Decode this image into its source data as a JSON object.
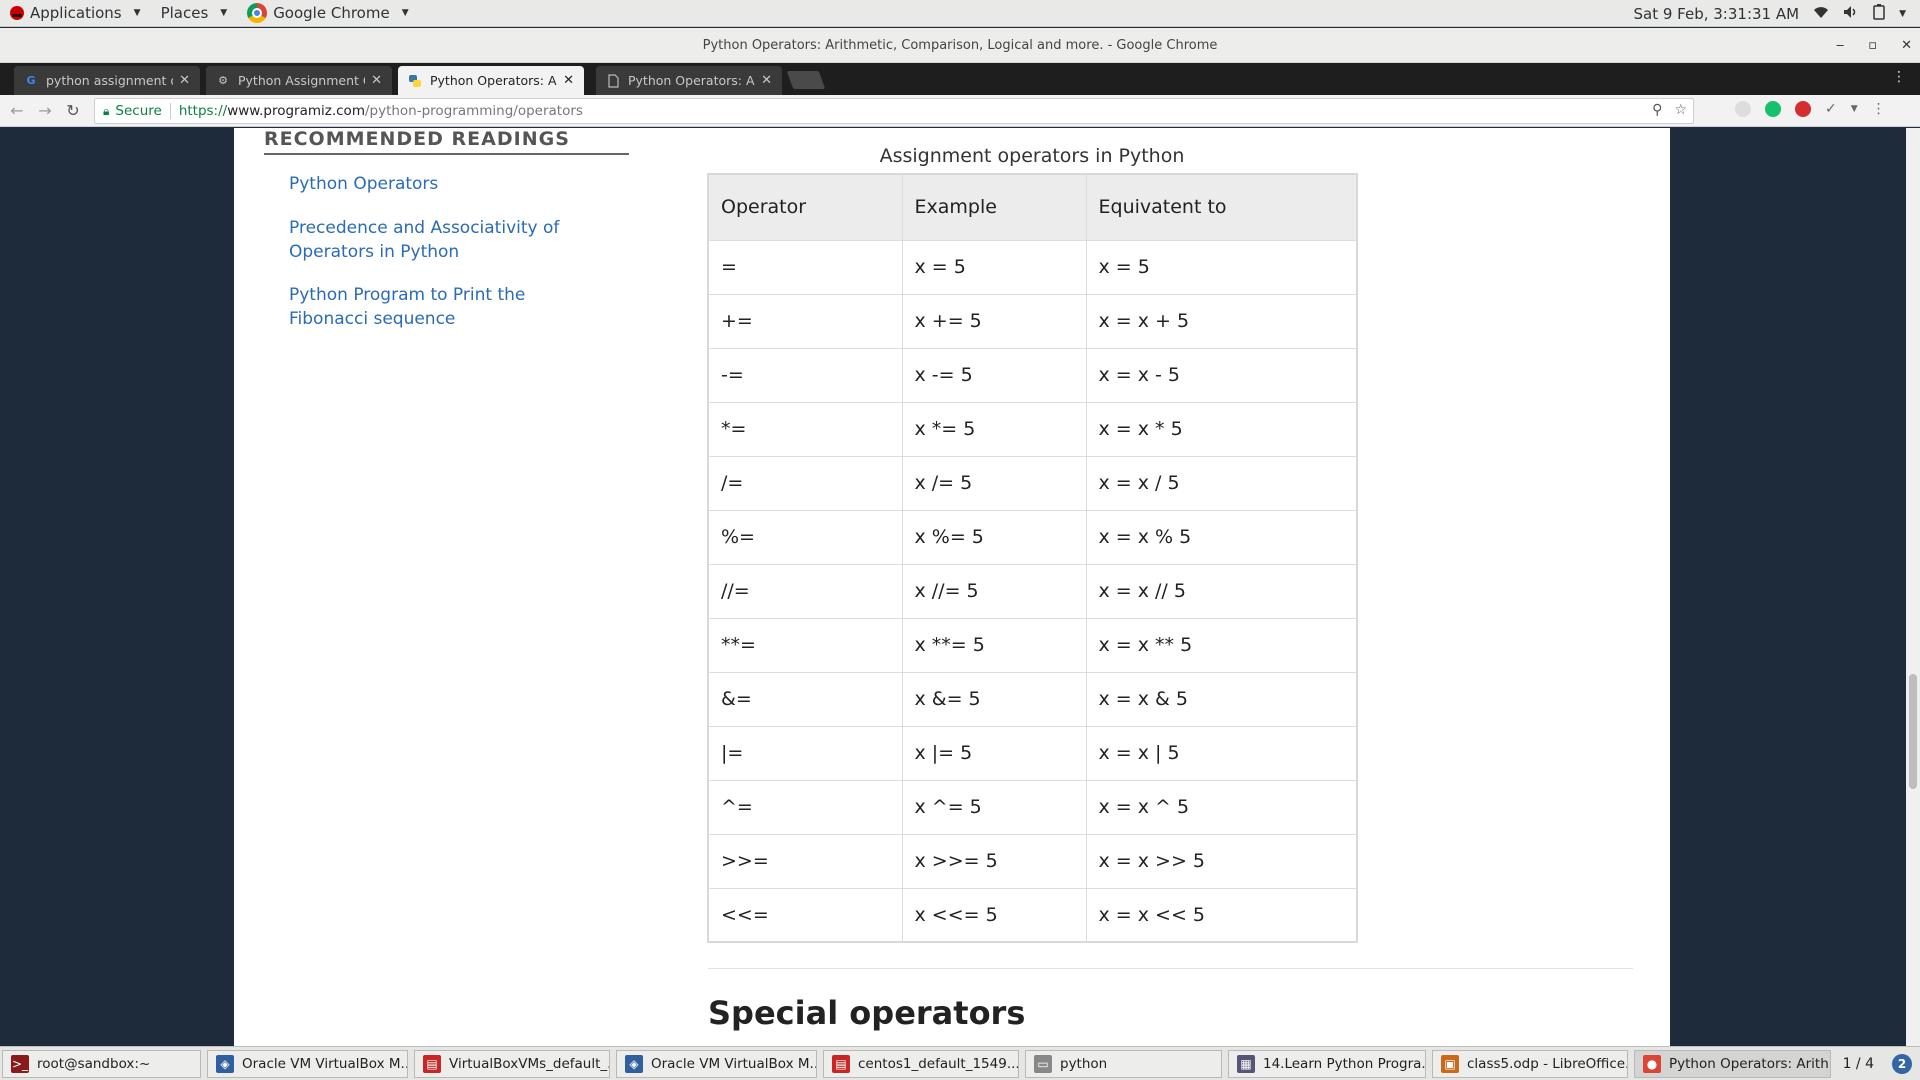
{
  "topbar": {
    "applications": "Applications",
    "places": "Places",
    "active_app": "Google Chrome",
    "clock": "Sat  9 Feb,  3:31:31 AM"
  },
  "window": {
    "title": "Python Operators: Arithmetic, Comparison, Logical and more. - Google Chrome"
  },
  "tabs": [
    {
      "label": "python assignment op",
      "favicon": "google-icon",
      "active": false
    },
    {
      "label": "Python Assignment Op",
      "favicon": "gear-icon",
      "active": false
    },
    {
      "label": "Python Operators: Arit",
      "favicon": "python-icon",
      "active": true
    },
    {
      "label": "Python Operators: Arit",
      "favicon": "page-icon",
      "active": false
    }
  ],
  "toolbar": {
    "secure_label": "Secure",
    "url_scheme": "https://",
    "url_host": "www.programiz.com",
    "url_path": "/python-programming/operators"
  },
  "sidebar": {
    "title": "RECOMMENDED READINGS",
    "links": [
      {
        "line1": "Python Operators",
        "line2": ""
      },
      {
        "line1": "Precedence and Associativity of",
        "line2": "Operators in Python"
      },
      {
        "line1": "Python Program to Print the",
        "line2": "Fibonacci sequence"
      }
    ]
  },
  "table": {
    "caption": "Assignment operators in Python",
    "headers": [
      "Operator",
      "Example",
      "Equivatent to"
    ],
    "rows": [
      [
        "=",
        "x = 5",
        "x = 5"
      ],
      [
        "+=",
        "x += 5",
        "x = x + 5"
      ],
      [
        "-=",
        "x -= 5",
        "x = x - 5"
      ],
      [
        "*=",
        "x *= 5",
        "x = x * 5"
      ],
      [
        "/=",
        "x /= 5",
        "x = x / 5"
      ],
      [
        "%=",
        "x %= 5",
        "x = x % 5"
      ],
      [
        "//=",
        "x //= 5",
        "x = x // 5"
      ],
      [
        "**=",
        "x **= 5",
        "x = x ** 5"
      ],
      [
        "&=",
        "x &= 5",
        "x = x & 5"
      ],
      [
        "|=",
        "x |= 5",
        "x = x | 5"
      ],
      [
        "^=",
        "x ^= 5",
        "x = x ^ 5"
      ],
      [
        ">>=",
        "x >>= 5",
        "x = x >> 5"
      ],
      [
        "<<=",
        "x <<= 5",
        "x = x << 5"
      ]
    ]
  },
  "section": {
    "title": "Special operators"
  },
  "taskbar": {
    "items": [
      {
        "label": "root@sandbox:~",
        "icon": "terminal-icon",
        "color": "#8b1a1a"
      },
      {
        "label": "Oracle VM VirtualBox M...",
        "icon": "virtualbox-icon",
        "color": "#2f5f9e"
      },
      {
        "label": "VirtualBoxVMs_default_...",
        "icon": "folder-icon",
        "color": "#c62828"
      },
      {
        "label": "Oracle VM VirtualBox M...",
        "icon": "virtualbox-icon",
        "color": "#2f5f9e"
      },
      {
        "label": "centos1_default_1549...",
        "icon": "folder-icon",
        "color": "#c62828"
      },
      {
        "label": "python",
        "icon": "window-icon",
        "color": "#888888"
      },
      {
        "label": "14.Learn Python Progra...",
        "icon": "pdf-icon",
        "color": "#555577"
      },
      {
        "label": "class5.odp - LibreOffice...",
        "icon": "impress-icon",
        "color": "#c8691c"
      },
      {
        "label": "Python Operators: Arith...",
        "icon": "chrome-icon",
        "color": "#db4437"
      }
    ],
    "pager": "1 / 4"
  },
  "colors": {
    "link": "#2a6bb5",
    "page_bg": "#1e2b3a",
    "secure_green": "#0b8043"
  }
}
